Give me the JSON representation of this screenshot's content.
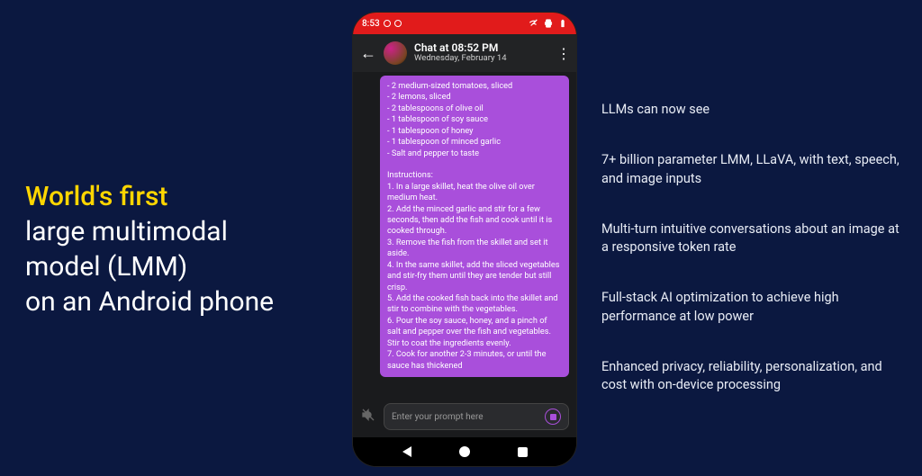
{
  "left": {
    "line1": "World's first",
    "line2": "large multimodal",
    "line3": "model (LMM)",
    "line4": "on an Android phone"
  },
  "bullets": [
    "LLMs can now see",
    "7+ billion parameter LMM, LLaVA, with text, speech, and image inputs",
    "Multi-turn intuitive conversations about an image at a responsive token rate",
    "Full-stack AI optimization to achieve high performance at low power",
    "Enhanced privacy, reliability, personalization, and cost with on-device processing"
  ],
  "phone": {
    "status_time": "8:53",
    "chat_title": "Chat at 08:52 PM",
    "chat_subtitle": "Wednesday, February 14",
    "message": "- 2 medium-sized tomatoes, sliced\n- 2 lemons, sliced\n- 2 tablespoons of olive oil\n- 1 tablespoon of soy sauce\n- 1 tablespoon of honey\n- 1 tablespoon of minced garlic\n- Salt and pepper to taste\n\nInstructions:\n1. In a large skillet, heat the olive oil over medium heat.\n2. Add the minced garlic and stir for a few seconds, then add the fish and cook until it is cooked through.\n3. Remove the fish from the skillet and set it aside.\n4. In the same skillet, add the sliced vegetables and stir-fry them until they are tender but still crisp.\n5. Add the cooked fish back into the skillet and stir to combine with the vegetables.\n6. Pour the soy sauce, honey, and a pinch of salt and pepper over the fish and vegetables. Stir to coat the ingredients evenly.\n7. Cook for another 2-3 minutes, or until the sauce has thickened",
    "input_placeholder": "Enter your prompt here"
  }
}
